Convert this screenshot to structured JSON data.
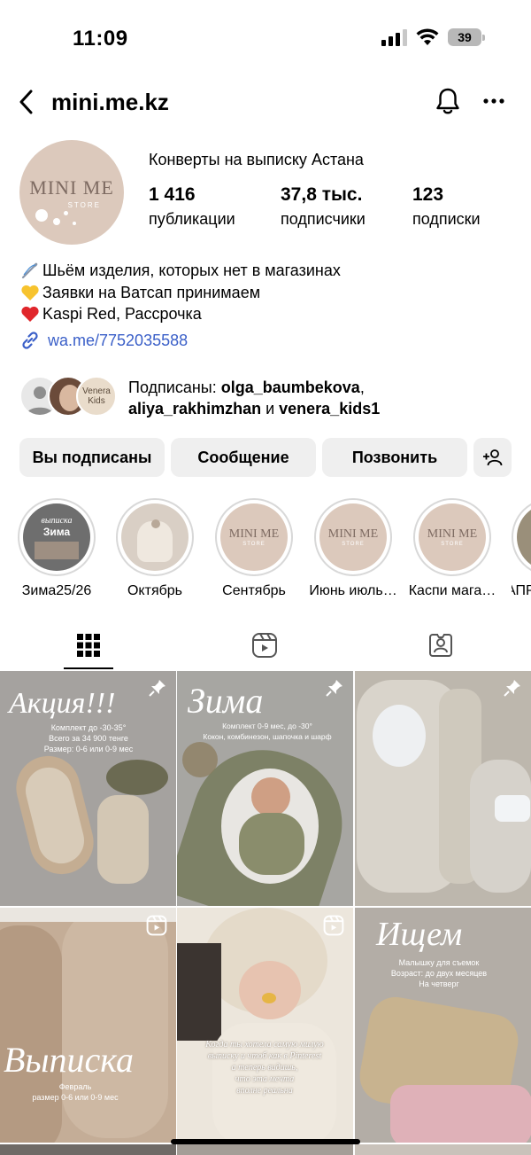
{
  "status_bar": {
    "time": "11:09",
    "battery": "39"
  },
  "header": {
    "username": "mini.me.kz"
  },
  "profile": {
    "avatar_brand": "MINI ME",
    "avatar_sub": "STORE",
    "display_name": "Конверты на выписку Астана",
    "stats": [
      {
        "value": "1 416",
        "label": "публикации"
      },
      {
        "value": "37,8 тыс.",
        "label": "подписчики"
      },
      {
        "value": "123",
        "label": "подписки"
      }
    ],
    "bio": [
      {
        "emoji": "needle",
        "text": "Шьём изделия, которых нет в магазинах"
      },
      {
        "emoji": "yellow-heart",
        "text": "Заявки на Ватсап принимаем"
      },
      {
        "emoji": "red-heart",
        "text": "Kaspi Red, Рассрочка"
      }
    ],
    "link": "wa.me/7752035588"
  },
  "followed_by": {
    "prefix": "Подписаны: ",
    "user1": "olga_baumbekova",
    "comma": ",",
    "user2": "aliya_rakhimzhan",
    "and": " и ",
    "user3": "venera_kids1",
    "avatar3_text": "Venera Kids"
  },
  "actions": {
    "following": "Вы подписаны",
    "message": "Сообщение",
    "call": "Позвонить"
  },
  "highlights": [
    {
      "label": "Зима25/26",
      "title": "Зима",
      "caption": "выписка"
    },
    {
      "label": "Октябрь"
    },
    {
      "label": "Сентябрь",
      "brand": "MINI ME",
      "sub": "STORE"
    },
    {
      "label": "Июнь июль…",
      "brand": "MINI ME",
      "sub": "STORE"
    },
    {
      "label": "Каспи мага…",
      "brand": "MINI ME",
      "sub": "STORE"
    },
    {
      "label": "АПР"
    }
  ],
  "posts": [
    {
      "title": "Акция!!!",
      "sub": "Комплект до -30-35°\nВсего за 34 900 тенге\nРазмер: 0-6 или 0-9 мес"
    },
    {
      "title": "Зима",
      "sub": "Комплект 0-9 мес, до -30°\nКокон, комбинезон, шапочка и шарф"
    },
    {},
    {
      "title": "Выписка",
      "sub": "Февраль\nразмер 0-6 или 0-9 мес"
    },
    {
      "sub": "Когда ты хотела самую милую\nвыписку и чтоб как в Pinterest\nа теперь видишь,\nчто эта мечта\nвполне реальна"
    },
    {
      "title": "Ищем",
      "sub": "Малышку для съемок\nВозраст: до двух месяцев\nНа четверг"
    }
  ],
  "colors": {
    "link": "#3a5fc8",
    "button_bg": "#efefef",
    "avatar_bg": "#dcc9bc"
  }
}
